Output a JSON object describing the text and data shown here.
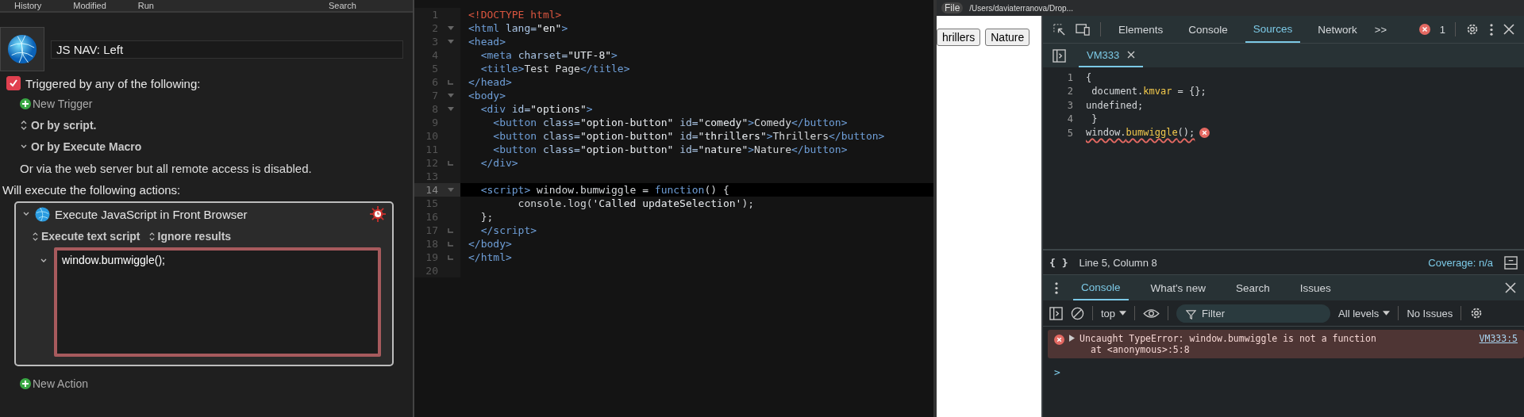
{
  "macro_editor": {
    "toolbar": [
      "History",
      "Modified",
      "Run",
      "Search"
    ],
    "macro_name": "JS NAV: Left",
    "trigger": {
      "checked": true,
      "label": "Triggered by any of the following:"
    },
    "new_trigger": "New Trigger",
    "options": [
      {
        "kind": "updown",
        "label": "Or by script."
      },
      {
        "kind": "down",
        "label": "Or by Execute Macro"
      }
    ],
    "note": "Or via the web server but all remote access is disabled.",
    "actions_heading": "Will execute the following actions:",
    "action": {
      "title": "Execute JavaScript in Front Browser",
      "expanded": true,
      "popups": [
        "Execute text script",
        "Ignore results"
      ],
      "script": "window.bumwiggle();"
    },
    "new_action": "New Action"
  },
  "code_editor": {
    "lines": [
      {
        "n": "1",
        "fold_start": false,
        "fold_end": false,
        "current": false,
        "segs": [
          {
            "kind": "doctype",
            "text": "<!DOCTYPE html>"
          }
        ]
      },
      {
        "n": "2",
        "fold_start": true,
        "fold_end": false,
        "current": false,
        "segs": [
          {
            "kind": "tag",
            "text": "<html "
          },
          {
            "kind": "attr",
            "text": "lang="
          },
          {
            "kind": "str",
            "text": "\"en\""
          },
          {
            "kind": "tag",
            "text": ">"
          }
        ]
      },
      {
        "n": "3",
        "fold_start": true,
        "fold_end": false,
        "current": false,
        "segs": [
          {
            "kind": "tag",
            "text": "<head>"
          }
        ]
      },
      {
        "n": "4",
        "fold_start": false,
        "fold_end": false,
        "current": false,
        "segs": [
          {
            "kind": "tag",
            "text": "  <meta "
          },
          {
            "kind": "attr",
            "text": "charset="
          },
          {
            "kind": "str",
            "text": "\"UTF-8\""
          },
          {
            "kind": "tag",
            "text": ">"
          }
        ]
      },
      {
        "n": "5",
        "fold_start": false,
        "fold_end": false,
        "current": false,
        "segs": [
          {
            "kind": "tag",
            "text": "  <title>"
          },
          {
            "kind": "plain",
            "text": "Test Page"
          },
          {
            "kind": "tag",
            "text": "</title>"
          }
        ]
      },
      {
        "n": "6",
        "fold_start": false,
        "fold_end": true,
        "current": false,
        "segs": [
          {
            "kind": "tag",
            "text": "</head>"
          }
        ]
      },
      {
        "n": "7",
        "fold_start": true,
        "fold_end": false,
        "current": false,
        "segs": [
          {
            "kind": "tag",
            "text": "<body>"
          }
        ]
      },
      {
        "n": "8",
        "fold_start": true,
        "fold_end": false,
        "current": false,
        "segs": [
          {
            "kind": "tag",
            "text": "  <div "
          },
          {
            "kind": "attr",
            "text": "id="
          },
          {
            "kind": "str",
            "text": "\"options\""
          },
          {
            "kind": "tag",
            "text": ">"
          }
        ]
      },
      {
        "n": "9",
        "fold_start": false,
        "fold_end": false,
        "current": false,
        "segs": [
          {
            "kind": "tag",
            "text": "    <button "
          },
          {
            "kind": "attr",
            "text": "class="
          },
          {
            "kind": "str",
            "text": "\"option-button\" "
          },
          {
            "kind": "attr",
            "text": "id="
          },
          {
            "kind": "str",
            "text": "\"comedy\""
          },
          {
            "kind": "tag",
            "text": ">"
          },
          {
            "kind": "plain",
            "text": "Comedy"
          },
          {
            "kind": "tag",
            "text": "</button>"
          }
        ]
      },
      {
        "n": "10",
        "fold_start": false,
        "fold_end": false,
        "current": false,
        "segs": [
          {
            "kind": "tag",
            "text": "    <button "
          },
          {
            "kind": "attr",
            "text": "class="
          },
          {
            "kind": "str",
            "text": "\"option-button\" "
          },
          {
            "kind": "attr",
            "text": "id="
          },
          {
            "kind": "str",
            "text": "\"thrillers\""
          },
          {
            "kind": "tag",
            "text": ">"
          },
          {
            "kind": "plain",
            "text": "Thrillers"
          },
          {
            "kind": "tag",
            "text": "</button>"
          }
        ]
      },
      {
        "n": "11",
        "fold_start": false,
        "fold_end": false,
        "current": false,
        "segs": [
          {
            "kind": "tag",
            "text": "    <button "
          },
          {
            "kind": "attr",
            "text": "class="
          },
          {
            "kind": "str",
            "text": "\"option-button\" "
          },
          {
            "kind": "attr",
            "text": "id="
          },
          {
            "kind": "str",
            "text": "\"nature\""
          },
          {
            "kind": "tag",
            "text": ">"
          },
          {
            "kind": "plain",
            "text": "Nature"
          },
          {
            "kind": "tag",
            "text": "</button>"
          }
        ]
      },
      {
        "n": "12",
        "fold_start": false,
        "fold_end": true,
        "current": false,
        "segs": [
          {
            "kind": "tag",
            "text": "  </div>"
          }
        ]
      },
      {
        "n": "13",
        "fold_start": false,
        "fold_end": false,
        "current": false
      },
      {
        "n": "14",
        "fold_start": true,
        "fold_end": false,
        "current": true,
        "segs": [
          {
            "kind": "tag",
            "text": "  <script> "
          },
          {
            "kind": "plain",
            "text": "window.bumwiggle = "
          },
          {
            "kind": "kw",
            "text": "function"
          },
          {
            "kind": "plain",
            "text": "() {"
          }
        ]
      },
      {
        "n": "15",
        "fold_start": false,
        "fold_end": false,
        "current": false,
        "segs": [
          {
            "kind": "plain",
            "text": "        console.log("
          },
          {
            "kind": "str",
            "text": "'Called updateSelection'"
          },
          {
            "kind": "plain",
            "text": ");"
          }
        ]
      },
      {
        "n": "16",
        "fold_start": false,
        "fold_end": false,
        "current": false,
        "segs": [
          {
            "kind": "plain",
            "text": "  };"
          }
        ]
      },
      {
        "n": "17",
        "fold_start": false,
        "fold_end": true,
        "current": false,
        "segs": [
          {
            "kind": "tag",
            "text": "  </script>"
          }
        ]
      },
      {
        "n": "18",
        "fold_start": false,
        "fold_end": true,
        "current": false,
        "segs": [
          {
            "kind": "tag",
            "text": "</body>"
          }
        ]
      },
      {
        "n": "19",
        "fold_start": false,
        "fold_end": true,
        "current": false,
        "segs": [
          {
            "kind": "tag",
            "text": "</html>"
          }
        ]
      },
      {
        "n": "20",
        "fold_start": false,
        "fold_end": false,
        "current": false
      }
    ]
  },
  "browser": {
    "scheme_chip": "File",
    "address": "/Users/daviaterranova/Drop...",
    "page_buttons": [
      "hrillers",
      "Nature"
    ]
  },
  "devtools": {
    "tabs": [
      {
        "label": "Elements",
        "selected": false
      },
      {
        "label": "Console",
        "selected": false
      },
      {
        "label": "Sources",
        "selected": true
      },
      {
        "label": "Network",
        "selected": false
      }
    ],
    "more": ">>",
    "error_count": "1",
    "file_tab": "VM333",
    "source_lines": [
      {
        "n": "1",
        "error": false,
        "segs": [
          {
            "kind": "plain",
            "text": "{"
          }
        ]
      },
      {
        "n": "2",
        "error": false,
        "segs": [
          {
            "kind": "plain",
            "text": " document."
          },
          {
            "kind": "prop",
            "text": "kmvar"
          },
          {
            "kind": "plain",
            "text": " = {};"
          }
        ]
      },
      {
        "n": "3",
        "error": false,
        "segs": [
          {
            "kind": "plain",
            "text": "undefined;"
          }
        ]
      },
      {
        "n": "4",
        "error": false,
        "segs": [
          {
            "kind": "plain",
            "text": " }"
          }
        ]
      },
      {
        "n": "5",
        "error": true,
        "segs": [
          {
            "kind": "plain",
            "text": "window."
          },
          {
            "kind": "prop",
            "text": "bumwiggle"
          },
          {
            "kind": "plain",
            "text": "();"
          }
        ]
      }
    ],
    "pretty_print": "{ }",
    "position": "Line 5, Column 8",
    "coverage": "Coverage: n/a",
    "drawer_tabs": [
      {
        "label": "Console",
        "selected": true
      },
      {
        "label": "What's new",
        "selected": false
      },
      {
        "label": "Search",
        "selected": false
      },
      {
        "label": "Issues",
        "selected": false
      }
    ],
    "context": "top",
    "filter_placeholder": "Filter",
    "levels": "All levels",
    "issues": "No Issues",
    "messages": [
      {
        "kind": "error",
        "text": "Uncaught TypeError: window.bumwiggle is not a function",
        "detail": "at <anonymous>:5:8",
        "source": "VM333:5"
      }
    ],
    "prompt": ">"
  }
}
